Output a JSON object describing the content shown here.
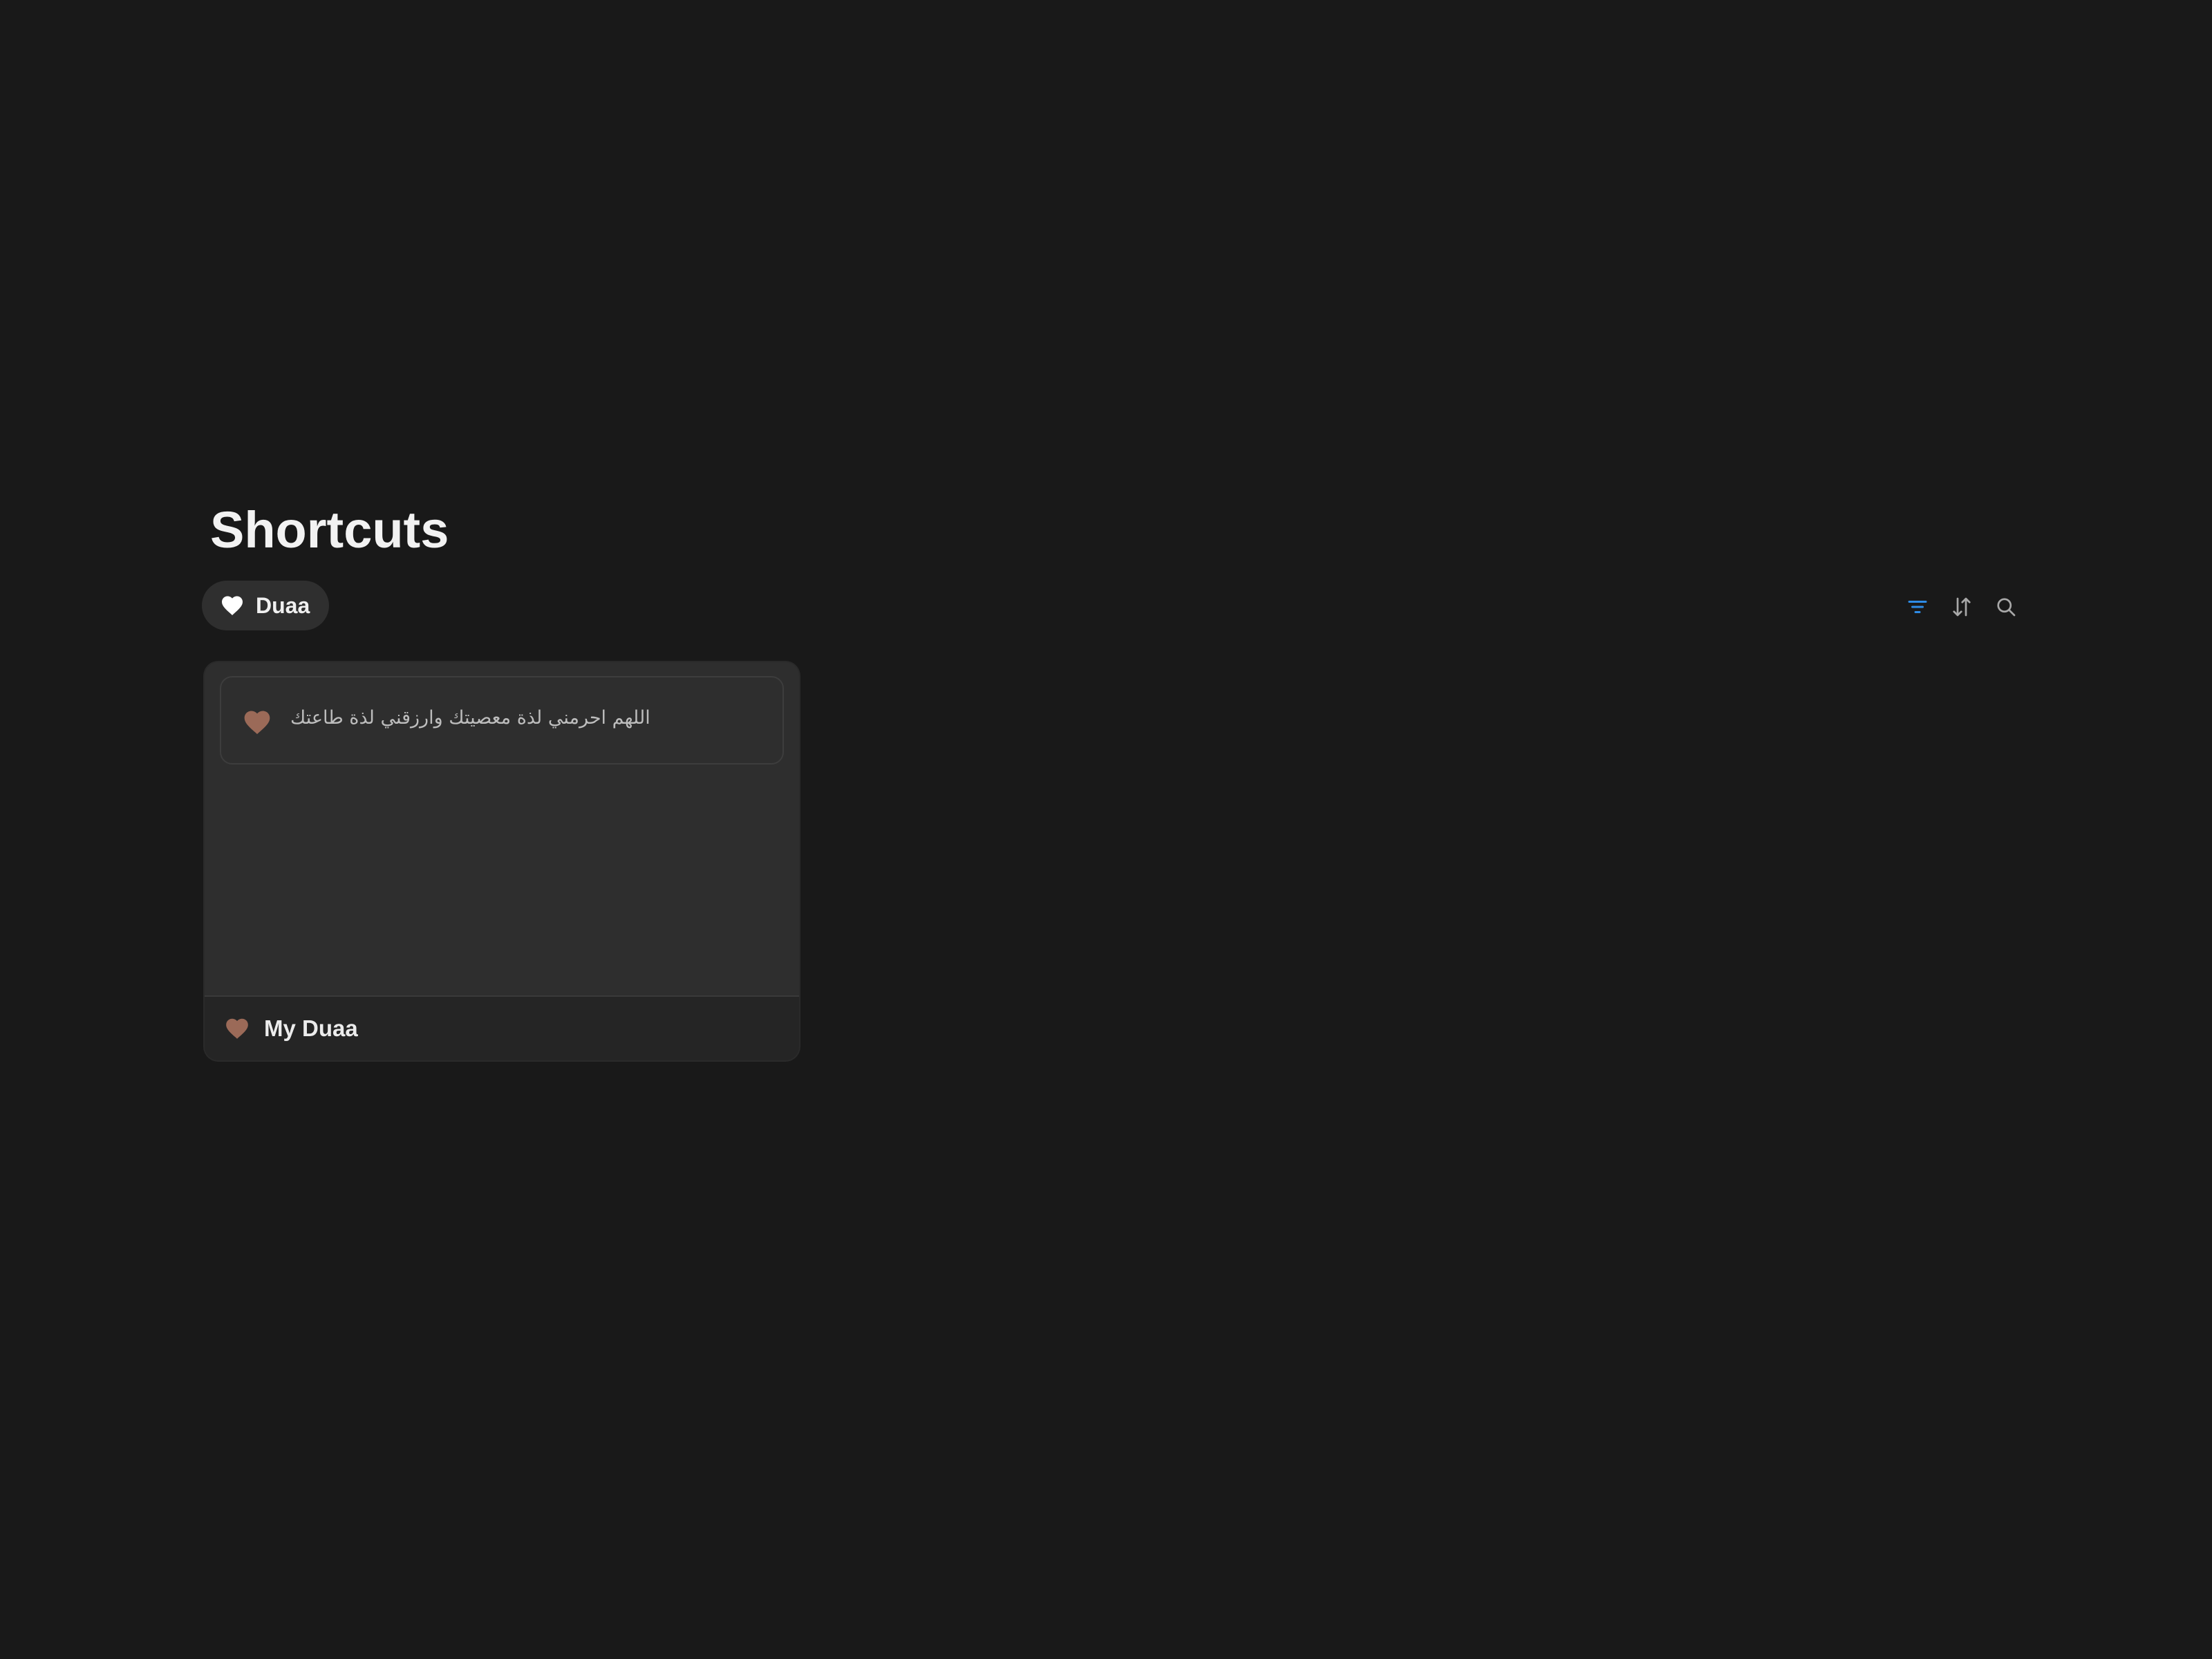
{
  "page": {
    "title": "Shortcuts"
  },
  "tab": {
    "label": "Duaa",
    "icon": "heart-icon",
    "icon_color": "#ffffff"
  },
  "toolbar": {
    "filter_icon": "filter-icon",
    "filter_color": "#2e8ce6",
    "sort_icon": "sort-icon",
    "search_icon": "search-icon",
    "icon_color": "#a8a8a8"
  },
  "card": {
    "preview_item": {
      "icon": "heart-icon",
      "icon_color": "#9b6a58",
      "text": "اللهم احرمني لذة معصيتك وارزقني لذة طاعتك"
    },
    "footer": {
      "icon": "heart-icon",
      "icon_color": "#9b6a58",
      "label": "My Duaa"
    }
  }
}
